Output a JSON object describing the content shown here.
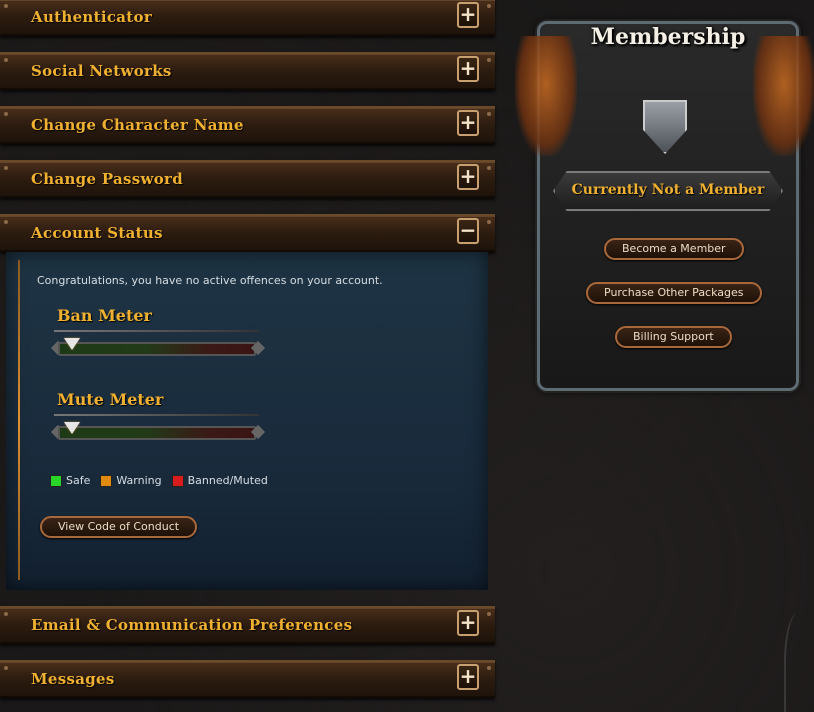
{
  "sections": {
    "authenticator": {
      "label": "Authenticator",
      "toggle": "+"
    },
    "social_networks": {
      "label": "Social Networks",
      "toggle": "+"
    },
    "change_character_name": {
      "label": "Change Character Name",
      "toggle": "+"
    },
    "change_password": {
      "label": "Change Password",
      "toggle": "+"
    },
    "account_status": {
      "label": "Account Status",
      "toggle": "−"
    },
    "email_prefs": {
      "label": "Email & Communication Preferences",
      "toggle": "+"
    },
    "messages": {
      "label": "Messages",
      "toggle": "+"
    }
  },
  "account_status": {
    "message": "Congratulations, you have no active offences on your account.",
    "ban_meter": {
      "title": "Ban Meter",
      "level": 0
    },
    "mute_meter": {
      "title": "Mute Meter",
      "level": 0
    },
    "legend": [
      {
        "label": "Safe",
        "color": "#2bd62b"
      },
      {
        "label": "Warning",
        "color": "#e08a10"
      },
      {
        "label": "Banned/Muted",
        "color": "#d61c1c"
      }
    ],
    "code_of_conduct_button": "View Code of Conduct"
  },
  "membership": {
    "title": "Membership",
    "status": "Currently Not a Member",
    "buttons": {
      "become_member": "Become a Member",
      "purchase_packages": "Purchase Other Packages",
      "billing_support": "Billing Support"
    }
  },
  "colors": {
    "accent_gold": "#f0b030",
    "panel_blue": "#1e3444",
    "button_border": "#a8683a"
  }
}
